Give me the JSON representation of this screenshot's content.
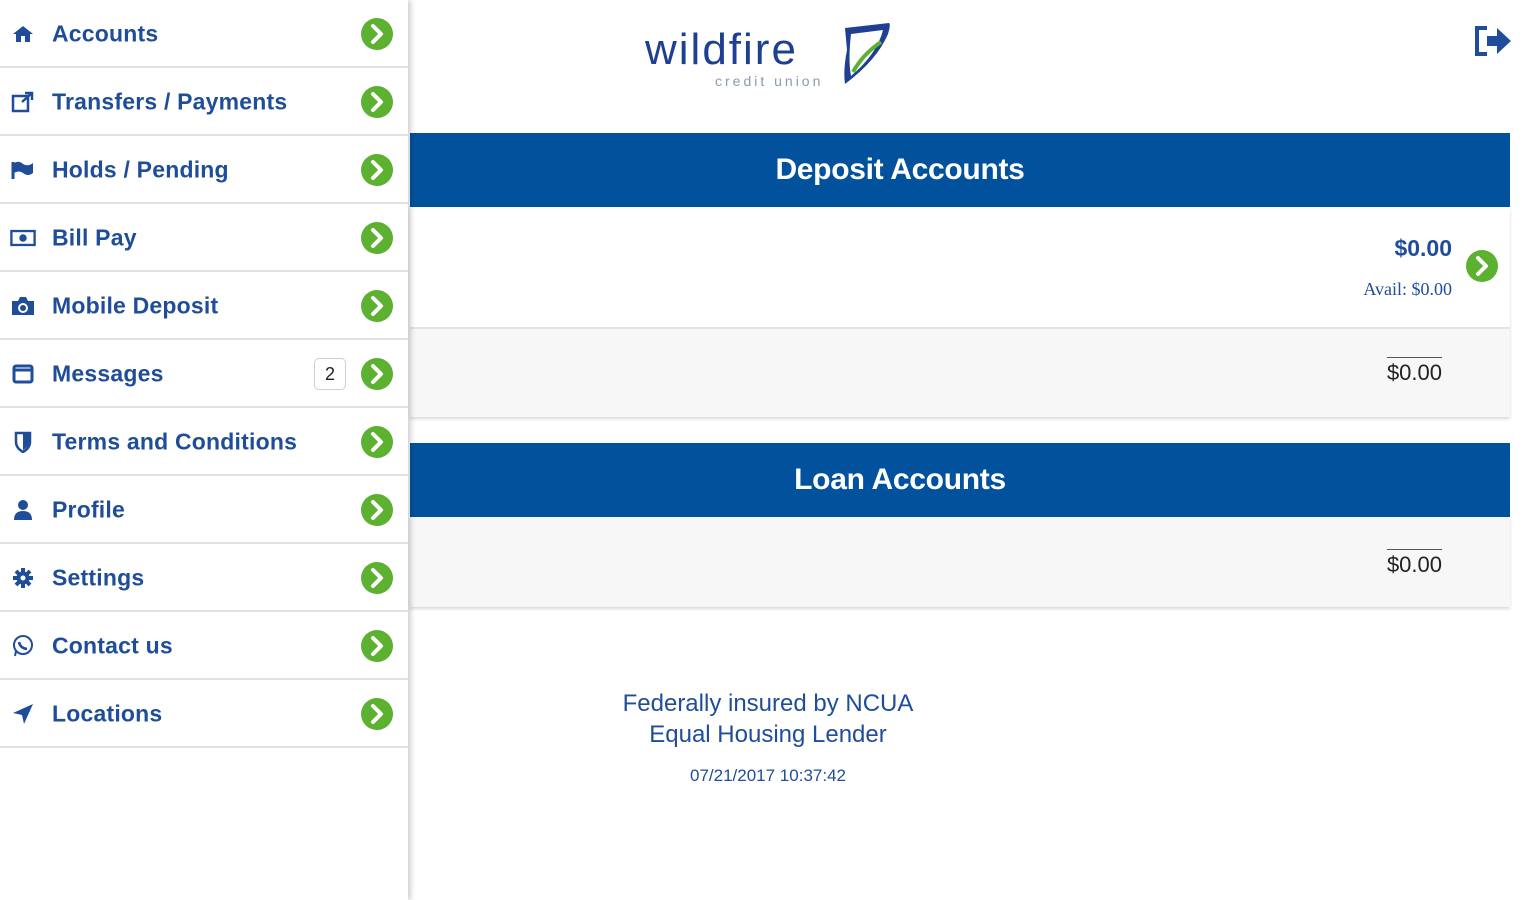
{
  "sidebar": {
    "items": [
      {
        "label": "Accounts",
        "icon": "home-icon"
      },
      {
        "label": "Transfers / Payments",
        "icon": "external-link-icon"
      },
      {
        "label": "Holds / Pending",
        "icon": "flag-icon"
      },
      {
        "label": "Bill Pay",
        "icon": "money-icon"
      },
      {
        "label": "Mobile Deposit",
        "icon": "camera-icon"
      },
      {
        "label": "Messages",
        "icon": "message-icon",
        "badge": "2"
      },
      {
        "label": "Terms and Conditions",
        "icon": "shield-icon"
      },
      {
        "label": "Profile",
        "icon": "user-icon"
      },
      {
        "label": "Settings",
        "icon": "gear-icon"
      },
      {
        "label": "Contact us",
        "icon": "whatsapp-icon"
      },
      {
        "label": "Locations",
        "icon": "location-arrow-icon"
      }
    ]
  },
  "header": {
    "logo_text": "wildfire",
    "logo_subtext": "credit union",
    "logout_icon": "logout-icon"
  },
  "deposit": {
    "title": "Deposit Accounts",
    "account": {
      "balance": "$0.00",
      "available": "Avail: $0.00"
    },
    "total": "$0.00"
  },
  "loan": {
    "title": "Loan Accounts",
    "total": "$0.00"
  },
  "footer": {
    "line1": "Federally insured by NCUA",
    "line2": "Equal Housing Lender",
    "timestamp": "07/21/2017 10:37:42"
  },
  "colors": {
    "brand_blue": "#02519c",
    "text_blue": "#1f4d9a",
    "accent_green": "#5cb130"
  }
}
